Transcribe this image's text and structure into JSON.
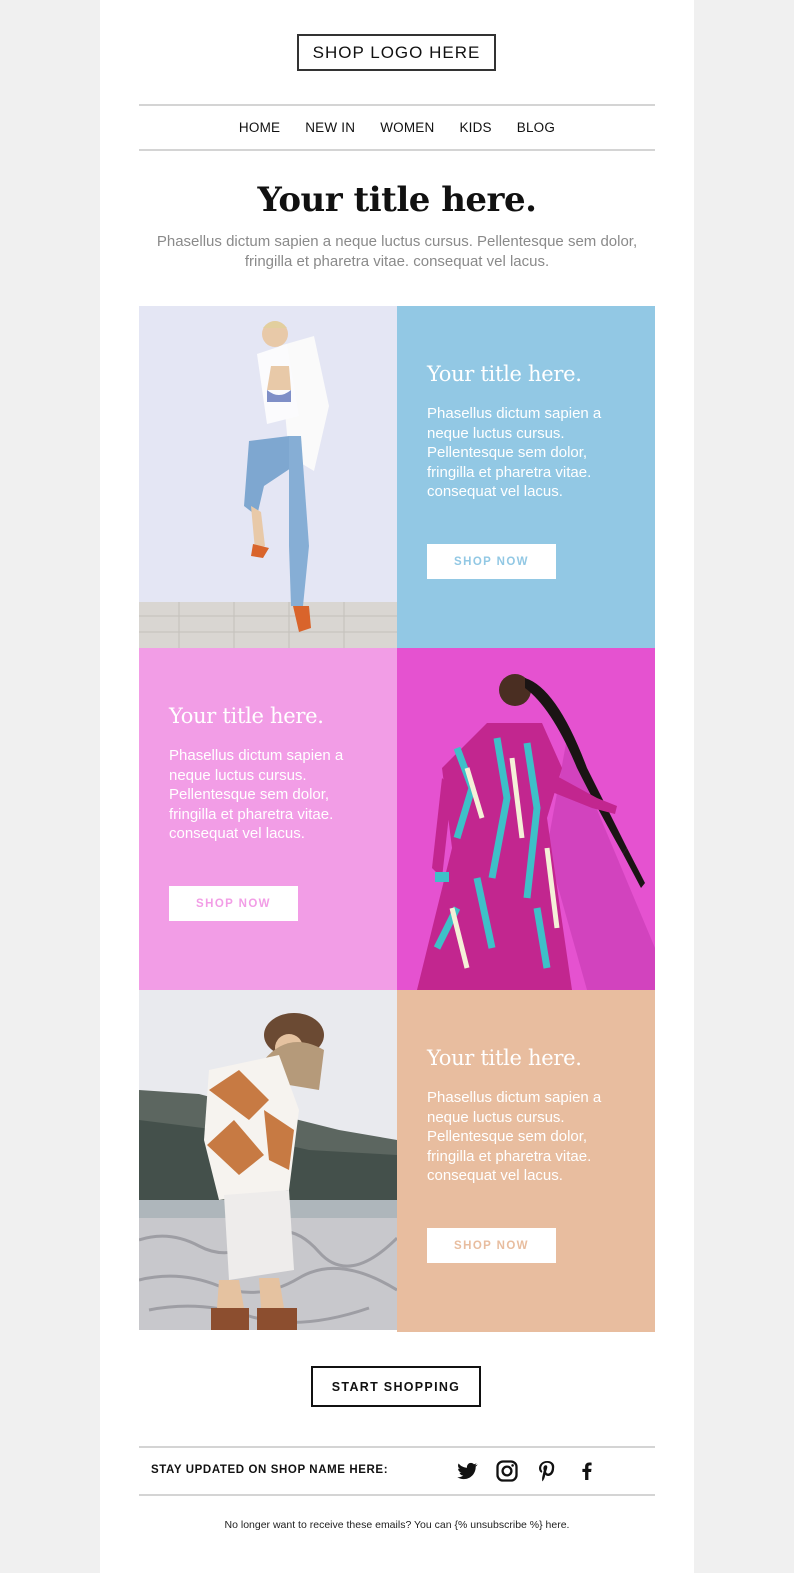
{
  "header": {
    "logo_text": "SHOP LOGO HERE"
  },
  "nav": {
    "items": [
      "HOME",
      "NEW IN",
      "WOMEN",
      "KIDS",
      "BLOG"
    ]
  },
  "hero": {
    "title": "Your title here.",
    "text": "Phasellus dictum sapien a neque luctus cursus. Pellentesque sem dolor, fringilla et pharetra vitae. consequat vel lacus."
  },
  "blocks": [
    {
      "title": "Your title here.",
      "text": "Phasellus dictum sapien a neque luctus cursus. Pellentesque sem dolor, fringilla et pharetra vitae. consequat vel lacus.",
      "button": "SHOP NOW",
      "bg_color": "#92c8e4",
      "button_text_color": "#92c8e4"
    },
    {
      "title": "Your title here.",
      "text": "Phasellus dictum sapien a neque luctus cursus. Pellentesque sem dolor, fringilla et pharetra vitae. consequat vel lacus.",
      "button": "SHOP NOW",
      "bg_color": "#f29de6",
      "button_text_color": "#f29de6"
    },
    {
      "title": "Your title here.",
      "text": "Phasellus dictum sapien a neque luctus cursus. Pellentesque sem dolor, fringilla et pharetra vitae. consequat vel lacus.",
      "button": "SHOP NOW",
      "bg_color": "#e8bd9f",
      "button_text_color": "#e8bd9f"
    }
  ],
  "cta": {
    "label": "START SHOPPING"
  },
  "social": {
    "label": "STAY UPDATED ON SHOP NAME HERE:",
    "icons": [
      "twitter-icon",
      "instagram-icon",
      "pinterest-icon",
      "facebook-icon"
    ]
  },
  "footer": {
    "text": "No longer want to receive these emails? You can {% unsubscribe %} here."
  }
}
